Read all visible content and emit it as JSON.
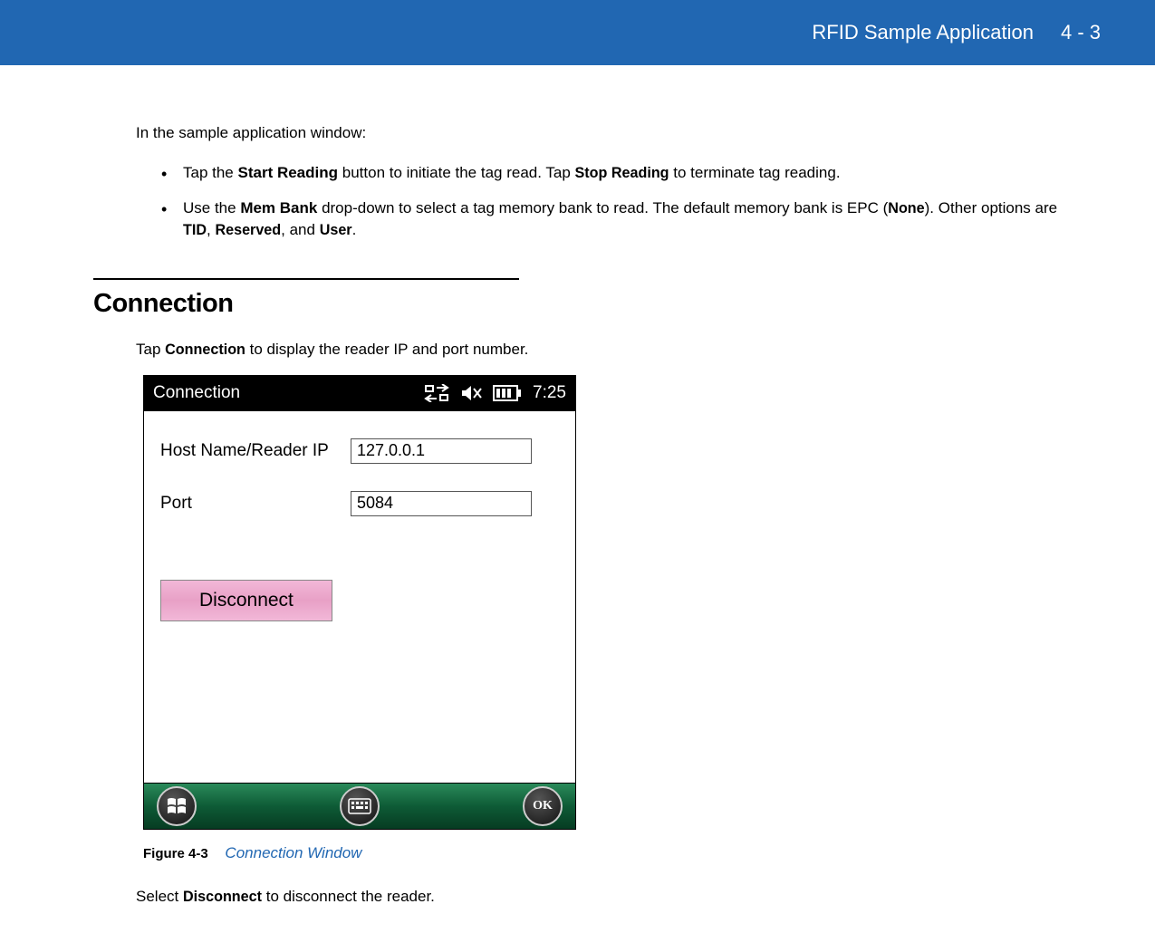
{
  "header": {
    "title": "RFID Sample Application",
    "page": "4 - 3"
  },
  "intro": "In the sample application window:",
  "bullets": [
    {
      "pre": "Tap the ",
      "b1": "Start Reading",
      "mid": " button to initiate the tag read. Tap ",
      "b2": "Stop Reading",
      "post": " to terminate tag reading."
    },
    {
      "pre": "Use the ",
      "b1": "Mem Bank",
      "mid": " drop-down to select a tag memory bank to read. The default memory bank is EPC (",
      "b2": "None",
      "mid2": "). Other options are ",
      "b3": "TID",
      "sep1": ", ",
      "b4": "Reserved",
      "sep2": ", and ",
      "b5": "User",
      "post": "."
    }
  ],
  "section": {
    "heading": "Connection",
    "text_pre": "Tap ",
    "text_bold": "Connection",
    "text_post": " to display the reader IP and port number."
  },
  "mobile": {
    "title": "Connection",
    "time": "7:25",
    "host_label": "Host Name/Reader IP",
    "host_value": "127.0.0.1",
    "port_label": "Port",
    "port_value": "5084",
    "disconnect": "Disconnect",
    "ok": "OK"
  },
  "figure": {
    "label": "Figure 4-3",
    "title": "Connection Window"
  },
  "closing": {
    "pre": "Select ",
    "bold": "Disconnect",
    "post": " to disconnect the reader."
  }
}
